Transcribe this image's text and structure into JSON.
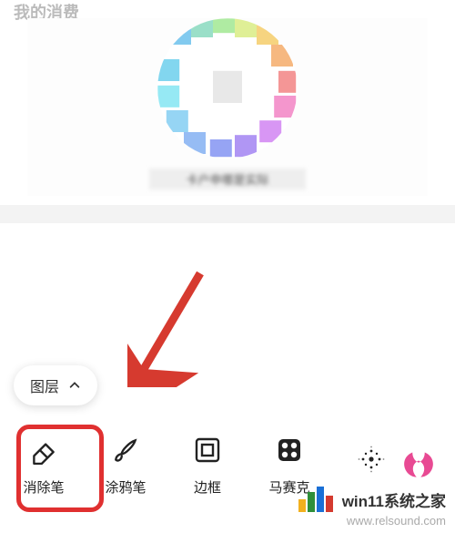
{
  "header": {
    "title": "我的消费"
  },
  "image": {
    "caption": "卡户申哪是实际"
  },
  "layer": {
    "label": "图层"
  },
  "tools": [
    {
      "id": "eraser",
      "label": "消除笔"
    },
    {
      "id": "scribble",
      "label": "涂鸦笔"
    },
    {
      "id": "frame",
      "label": "边框"
    },
    {
      "id": "mosaic",
      "label": "马赛克"
    },
    {
      "id": "blur",
      "label": ""
    }
  ],
  "watermark": {
    "title": "win11系统之家",
    "url": "www.relsound.com",
    "logo_colors": [
      "#f2b01e",
      "#2f8f3a",
      "#1a6fd6",
      "#d43a2f"
    ]
  },
  "colors": {
    "highlight": "#e03030",
    "arrow": "#d63a2f",
    "partial_icon": "#e84a93"
  }
}
